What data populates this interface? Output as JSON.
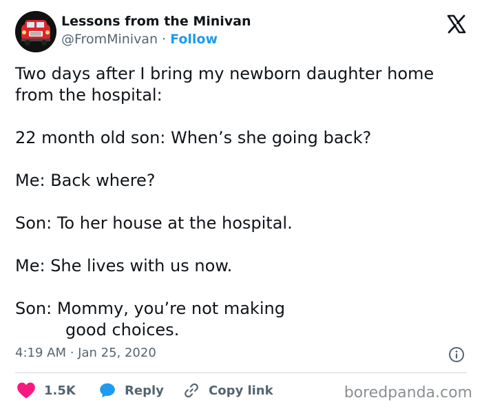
{
  "author": {
    "name": "Lessons from the Minivan",
    "handle": "@FromMinivan",
    "separator": "·",
    "follow_label": "Follow"
  },
  "tweet": {
    "lines": [
      "Two days after I bring my newborn daughter home",
      "from the hospital:",
      "",
      "22 month old son: When’s she going back?",
      "",
      "Me: Back where?",
      "",
      "Son: To her house at the hospital.",
      "",
      "Me: She lives with us now.",
      "",
      "Son: Mommy, you’re not making",
      "good choices."
    ]
  },
  "meta": {
    "timestamp": "4:19 AM · Jan 25, 2020"
  },
  "actions": {
    "like_count": "1.5K",
    "reply_label": "Reply",
    "copy_label": "Copy link"
  },
  "watermark": "boredpanda.com",
  "icons": {
    "brand_logo": "x-logo-icon",
    "info": "info-icon",
    "like": "heart-icon",
    "reply": "speech-bubble-icon",
    "copy": "link-icon"
  },
  "colors": {
    "link_blue": "#1d9bf0",
    "heart_red": "#f91880",
    "secondary_text": "#536471",
    "primary_text": "#0f1419"
  }
}
